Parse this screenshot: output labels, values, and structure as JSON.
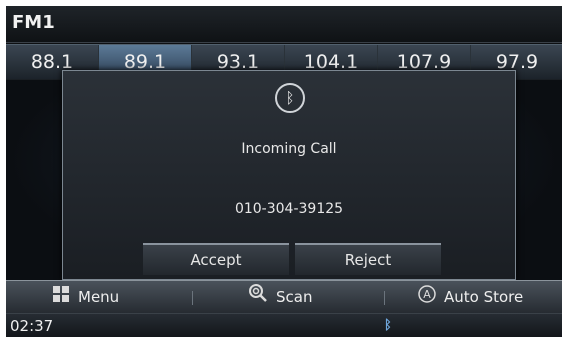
{
  "header": {
    "title": "FM1"
  },
  "presets": [
    "88.1",
    "89.1",
    "93.1",
    "104.1",
    "107.9",
    "97.9"
  ],
  "popup": {
    "icon": "bluetooth-icon",
    "title": "Incoming Call",
    "number": "010-304-39125",
    "accept_label": "Accept",
    "reject_label": "Reject"
  },
  "bottom_bar": {
    "menu_label": "Menu",
    "scan_label": "Scan",
    "auto_store_label": "Auto Store"
  },
  "status": {
    "time": "02:37"
  },
  "colors": {
    "background": "#0d0f12",
    "active_preset": "#5c7a97",
    "bluetooth_status": "#6fa7dd"
  }
}
